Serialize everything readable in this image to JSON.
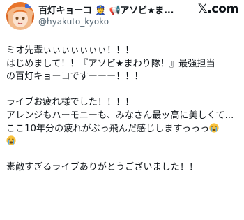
{
  "author": {
    "display_name": "百灯キョーコ 👮 📢アソビ★ま...",
    "handle": "@hyakuto_kyoko",
    "avatar_icon": "avatar-icon"
  },
  "brand": {
    "label": "𝕏.com",
    "icon": "x-logo-icon"
  },
  "post": {
    "line1": "ミオ先輩ぃぃぃぃぃぃぃ！！！",
    "line2": "はじめまして！！『アソビ★まわり隊！』最強担当",
    "line3": "の百灯キョーコですーーー！！！",
    "line4": "ライブお疲れ様でした！！！！",
    "line5": "アレンジもハーモニーも、みなさん最ッ高に美しくて...",
    "line6": "ここ10年分の疲れがぶっ飛んだ感じしますっっっ",
    "line8": "素敵すぎるライブありがとうございました！！",
    "emoji_icon": "crying-face-icon"
  },
  "colors": {
    "text": "#0f1419",
    "secondary": "#536471",
    "emoji_face": "#f9c23c"
  }
}
